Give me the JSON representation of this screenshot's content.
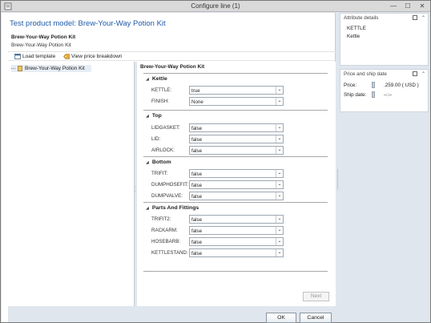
{
  "window": {
    "title": "Configure line (1)",
    "minimize": "—",
    "maximize": "☐",
    "close": "✕"
  },
  "header": {
    "heading": "Test product model: Brew-Your-Way Potion Kit",
    "subtitle_bold": "Brew-Your-Way Potion Kit",
    "subtitle": "Brew-Your-Way Potion Kit"
  },
  "toolbar": {
    "load_template": "Load template",
    "view_price_breakdown": "View price breakdown"
  },
  "tree": {
    "items": [
      {
        "label": "Brew-Your-Way Potion Kit"
      }
    ]
  },
  "attributes": {
    "title": "Brew-Your-Way Potion Kit",
    "groups": [
      {
        "name": "Kettle",
        "fields": [
          {
            "label": "KETTLE:",
            "value": "true"
          },
          {
            "label": "FINISH:",
            "value": "None"
          }
        ]
      },
      {
        "name": "Top",
        "fields": [
          {
            "label": "LIDGASKET:",
            "value": "false"
          },
          {
            "label": "LID:",
            "value": "false"
          },
          {
            "label": "AIRLOCK:",
            "value": "false"
          }
        ]
      },
      {
        "name": "Bottom",
        "fields": [
          {
            "label": "TRIFIT:",
            "value": "false"
          },
          {
            "label": "DUMPHOSEFIT:",
            "value": "false"
          },
          {
            "label": "DUMPVALVE:",
            "value": "false"
          }
        ]
      },
      {
        "name": "Parts And Fittings",
        "fields": [
          {
            "label": "TRIFIT2:",
            "value": "false"
          },
          {
            "label": "RACKARM:",
            "value": "false"
          },
          {
            "label": "HOSEBARB:",
            "value": "false"
          },
          {
            "label": "KETTLESTAND:",
            "value": "false"
          }
        ]
      }
    ],
    "next_label": "Next"
  },
  "footer": {
    "ok_label": "OK",
    "cancel_label": "Cancel"
  },
  "right": {
    "attribute_details": {
      "title": "Attribute details",
      "name": "KETTLE",
      "description": "Kettle"
    },
    "price_ship": {
      "title": "Price and ship date",
      "price_label": "Price:",
      "price_value": ".259.00 ( USD )",
      "ship_label": "Ship date:",
      "ship_value": "--:--"
    }
  },
  "colors": {
    "heading": "#1e5aa8",
    "frame": "#dfe6ee",
    "selection": "#e7edf5"
  }
}
